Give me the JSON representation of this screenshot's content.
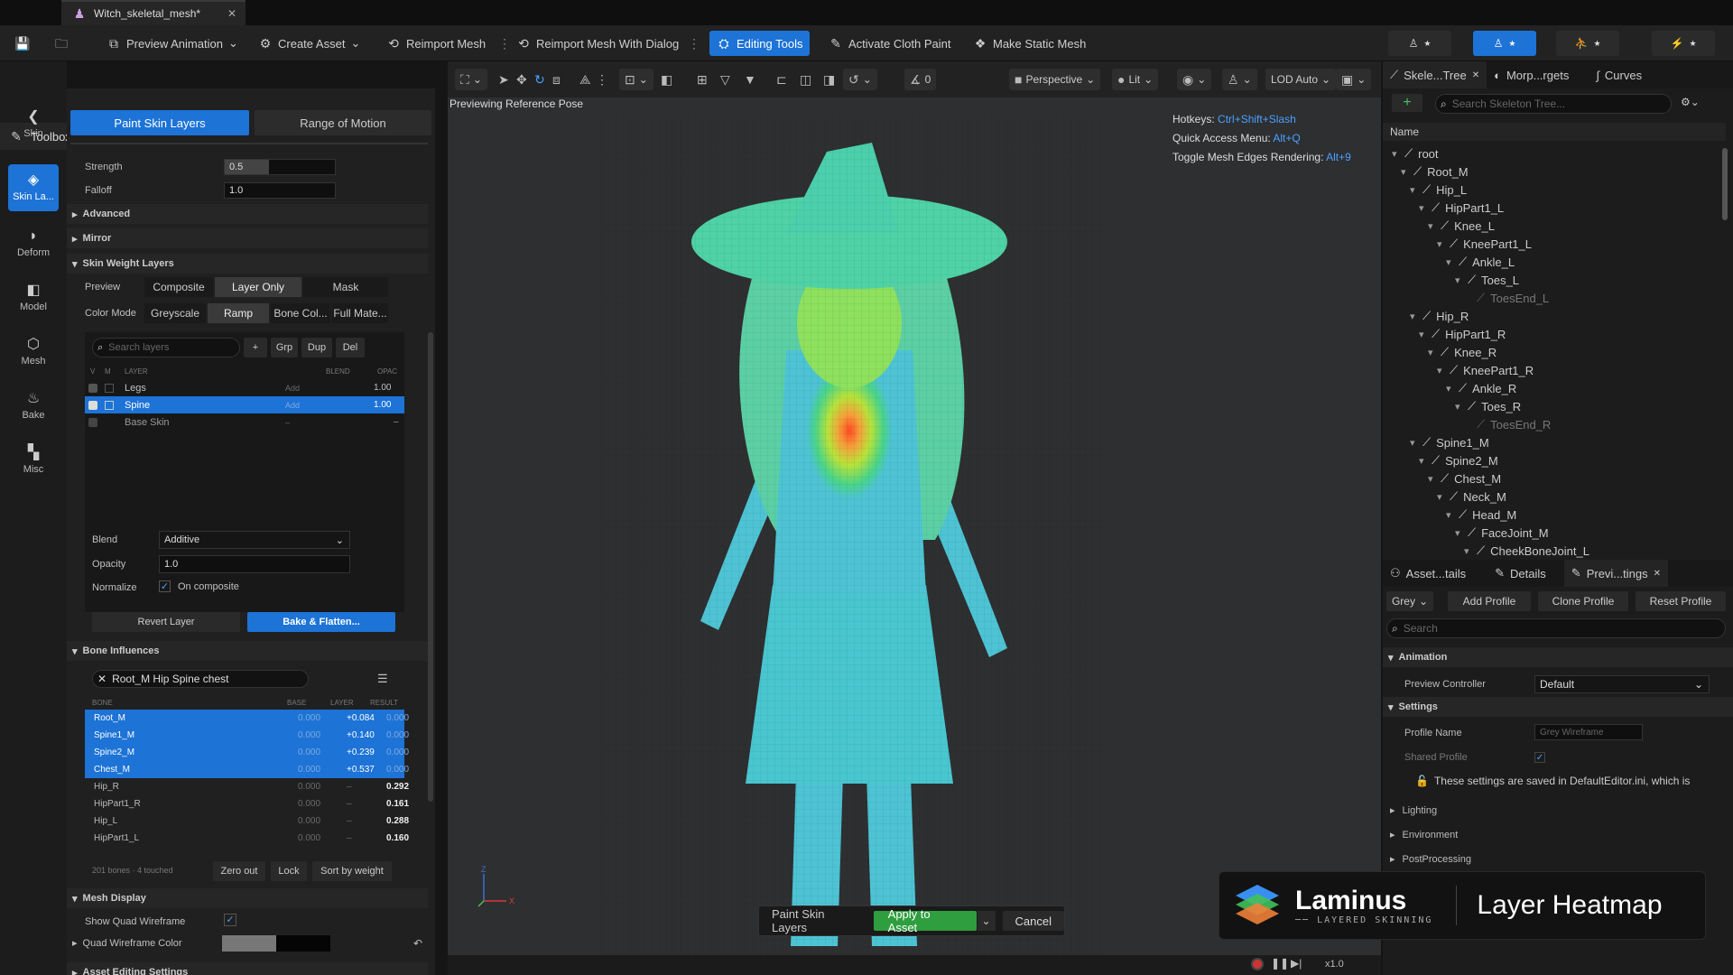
{
  "titlebar": {
    "tab_title": "Witch_skeletal_mesh*"
  },
  "toolbar": {
    "preview_animation": "Preview Animation",
    "create_asset": "Create Asset",
    "reimport_mesh": "Reimport Mesh",
    "reimport_mesh_dialog": "Reimport Mesh With Dialog",
    "editing_tools": "Editing Tools",
    "activate_cloth_paint": "Activate Cloth Paint",
    "make_static_mesh": "Make Static Mesh"
  },
  "rail": {
    "items": [
      "Skin",
      "Skin La...",
      "Deform",
      "Model",
      "Mesh",
      "Bake",
      "Misc"
    ]
  },
  "toolbox": {
    "tab_title": "Toolbox",
    "mode_paint": "Paint Skin Layers",
    "mode_range": "Range of Motion",
    "strength_label": "Strength",
    "strength_value": "0.5",
    "falloff_label": "Falloff",
    "falloff_value": "1.0",
    "advanced": "Advanced",
    "mirror": "Mirror",
    "skin_weight_layers": "Skin Weight Layers",
    "preview_label": "Preview",
    "preview_options": [
      "Composite",
      "Layer Only",
      "Mask"
    ],
    "color_mode_label": "Color Mode",
    "color_mode_options": [
      "Greyscale",
      "Ramp",
      "Bone Col...",
      "Full Mate..."
    ],
    "search_layers_placeholder": "Search layers",
    "layer_buttons": [
      "+",
      "Grp",
      "Dup",
      "Del"
    ],
    "layer_headers": [
      "V",
      "M",
      "LAYER",
      "BLEND",
      "OPAC"
    ],
    "layers": [
      {
        "name": "Legs",
        "blend": "Add",
        "opacity": "1.00"
      },
      {
        "name": "Spine",
        "blend": "Add",
        "opacity": "1.00"
      },
      {
        "name": "Base Skin",
        "blend": "–",
        "opacity": "–"
      }
    ],
    "blend_label": "Blend",
    "blend_value": "Additive",
    "opacity_label": "Opacity",
    "opacity_value": "1.0",
    "normalize_label": "Normalize",
    "normalize_value": "On composite",
    "revert_layer": "Revert Layer",
    "bake_flatten": "Bake & Flatten...",
    "bone_influences": "Bone Influences",
    "bone_filter": "Root_M Hip Spine chest",
    "bone_headers": [
      "BONE",
      "BASE",
      "LAYER",
      "RESULT"
    ],
    "bones": [
      {
        "name": "Root_M",
        "base": "0.000",
        "layer": "+0.084",
        "result": "0.000"
      },
      {
        "name": "Spine1_M",
        "base": "0.000",
        "layer": "+0.140",
        "result": "0.000"
      },
      {
        "name": "Spine2_M",
        "base": "0.000",
        "layer": "+0.239",
        "result": "0.000"
      },
      {
        "name": "Chest_M",
        "base": "0.000",
        "layer": "+0.537",
        "result": "0.000"
      },
      {
        "name": "Hip_R",
        "base": "0.000",
        "layer": "–",
        "result": "0.292"
      },
      {
        "name": "HipPart1_R",
        "base": "0.000",
        "layer": "–",
        "result": "0.161"
      },
      {
        "name": "Hip_L",
        "base": "0.000",
        "layer": "–",
        "result": "0.288"
      },
      {
        "name": "HipPart1_L",
        "base": "0.000",
        "layer": "–",
        "result": "0.160"
      }
    ],
    "bones_footer": "201 bones · 4 touched",
    "zero_out": "Zero out",
    "lock": "Lock",
    "sort_by_weight": "Sort by weight",
    "mesh_display": "Mesh Display",
    "show_quad_wireframe": "Show Quad Wireframe",
    "quad_wireframe_color": "Quad Wireframe Color",
    "asset_editing_settings": "Asset Editing Settings"
  },
  "viewport": {
    "previewing": "Previewing Reference Pose",
    "perspective": "Perspective",
    "lit": "Lit",
    "lod": "LOD Auto",
    "angle_value": "0",
    "hotkeys_label": "Hotkeys:",
    "hotkeys_value": "Ctrl+Shift+Slash",
    "quick_access_label": "Quick Access Menu:",
    "quick_access_value": "Alt+Q",
    "toggle_edges_label": "Toggle Mesh Edges Rendering:",
    "toggle_edges_value": "Alt+9",
    "play_speed": "x1.0",
    "popup_label": "Paint Skin Layers",
    "apply_to_asset": "Apply to Asset",
    "cancel": "Cancel"
  },
  "skeleton_panel": {
    "tabs": [
      "Skele...Tree",
      "Morp...rgets",
      "Curves"
    ],
    "search_placeholder": "Search Skeleton Tree...",
    "column_name": "Name",
    "bones": [
      {
        "name": "root",
        "depth": 0
      },
      {
        "name": "Root_M",
        "depth": 1
      },
      {
        "name": "Hip_L",
        "depth": 2
      },
      {
        "name": "HipPart1_L",
        "depth": 3
      },
      {
        "name": "Knee_L",
        "depth": 4
      },
      {
        "name": "KneePart1_L",
        "depth": 5
      },
      {
        "name": "Ankle_L",
        "depth": 6
      },
      {
        "name": "Toes_L",
        "depth": 7
      },
      {
        "name": "ToesEnd_L",
        "depth": 8,
        "dim": true
      },
      {
        "name": "Hip_R",
        "depth": 2
      },
      {
        "name": "HipPart1_R",
        "depth": 3
      },
      {
        "name": "Knee_R",
        "depth": 4
      },
      {
        "name": "KneePart1_R",
        "depth": 5
      },
      {
        "name": "Ankle_R",
        "depth": 6
      },
      {
        "name": "Toes_R",
        "depth": 7
      },
      {
        "name": "ToesEnd_R",
        "depth": 8,
        "dim": true
      },
      {
        "name": "Spine1_M",
        "depth": 2
      },
      {
        "name": "Spine2_M",
        "depth": 3
      },
      {
        "name": "Chest_M",
        "depth": 4
      },
      {
        "name": "Neck_M",
        "depth": 5
      },
      {
        "name": "Head_M",
        "depth": 6
      },
      {
        "name": "FaceJoint_M",
        "depth": 7
      },
      {
        "name": "CheekBoneJoint_L",
        "depth": 8
      }
    ]
  },
  "details_panel": {
    "tabs": [
      "Asset...tails",
      "Details",
      "Previ...tings"
    ],
    "profile_dropdown": "Grey",
    "add_profile": "Add Profile",
    "clone_profile": "Clone Profile",
    "reset_profile": "Reset Profile",
    "search_placeholder": "Search",
    "animation": "Animation",
    "preview_controller_label": "Preview Controller",
    "preview_controller_value": "Default",
    "settings": "Settings",
    "profile_name_label": "Profile Name",
    "profile_name_value": "Grey Wireframe",
    "shared_profile_label": "Shared Profile",
    "notice": "These settings are saved in DefaultEditor.ini, which is",
    "lighting": "Lighting",
    "environment": "Environment",
    "postprocessing": "PostProcessing"
  },
  "brand": {
    "name": "Laminus",
    "tagline": "LAYERED SKINNING",
    "title": "Layer Heatmap"
  },
  "colors": {
    "accent": "#1d73d6",
    "apply_green": "#2f9e3e"
  }
}
